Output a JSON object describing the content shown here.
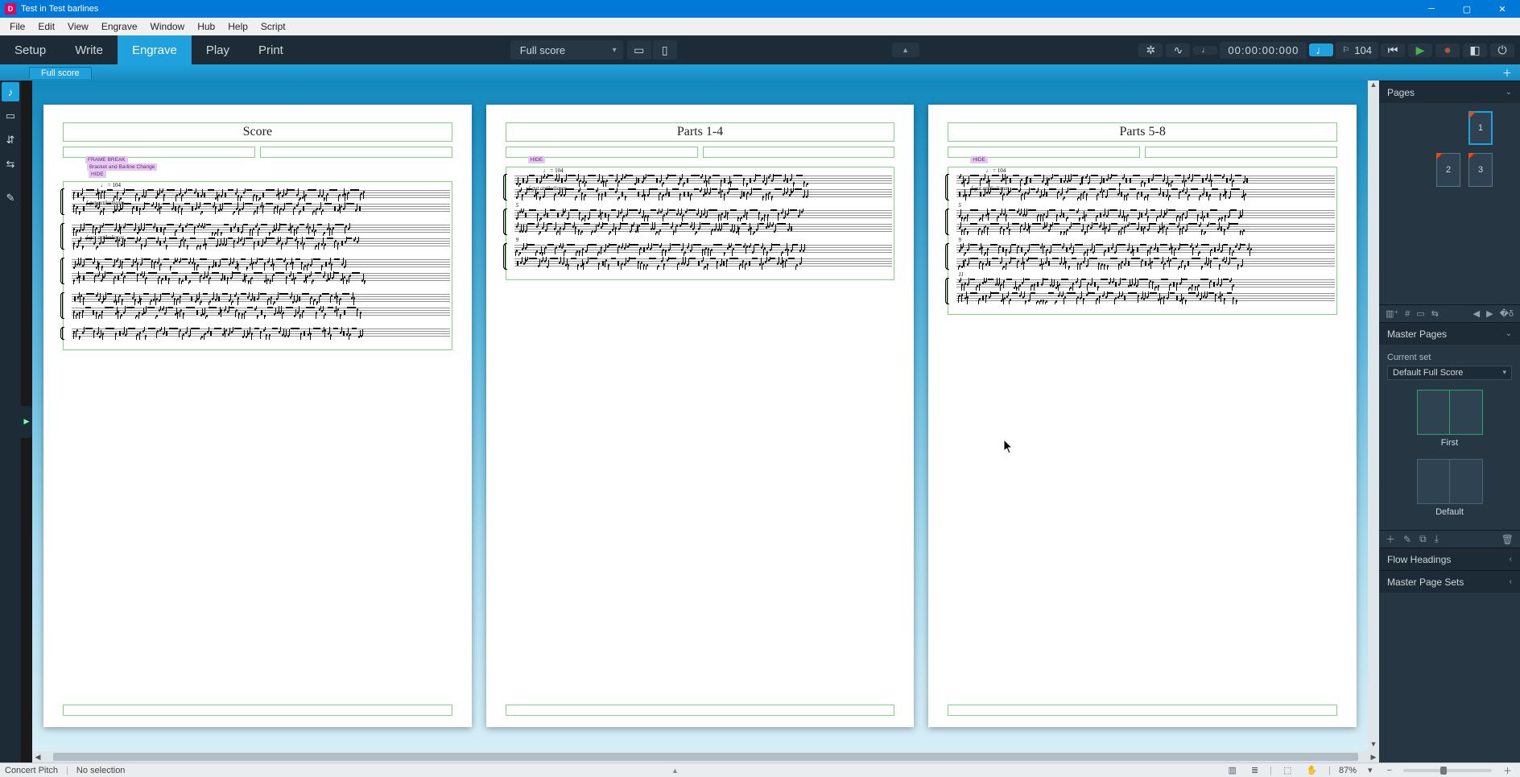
{
  "window": {
    "title": "Test in Test barlines"
  },
  "menubar": [
    "File",
    "Edit",
    "View",
    "Engrave",
    "Window",
    "Hub",
    "Help",
    "Script"
  ],
  "modes": {
    "items": [
      "Setup",
      "Write",
      "Engrave",
      "Play",
      "Print"
    ],
    "active": "Engrave"
  },
  "layout_selector": {
    "value": "Full score"
  },
  "transport": {
    "tempo_note": "♩",
    "tempo_value": "104",
    "timecode": "00:00:00:000"
  },
  "doc_tabs": {
    "items": [
      "Full score"
    ],
    "active": 0
  },
  "canvas": {
    "pages": [
      {
        "title": "Score",
        "signposts": [
          "FRAME BREAK",
          "Bracket and Barline Change",
          "HIDE"
        ],
        "tempo_text": "♩ = 104",
        "dynamic_text": "f  gut artikulieren",
        "systems": [
          {
            "staves": 2,
            "bar_number": null,
            "has_dynamic": true
          },
          {
            "staves": 2,
            "bar_number": null,
            "has_dynamic": true
          },
          {
            "staves": 2,
            "bar_number": null,
            "has_dynamic": false
          },
          {
            "staves": 2,
            "bar_number": null,
            "has_dynamic": false
          },
          {
            "staves": 1,
            "bar_number": null,
            "has_dynamic": false
          }
        ]
      },
      {
        "title": "Parts 1-4",
        "signposts": [
          "HIDE"
        ],
        "tempo_text": "♩ = 104",
        "dynamic_text": "f  gut artikulieren",
        "systems": [
          {
            "staves": 2,
            "bar_number": null,
            "has_dynamic": true
          },
          {
            "staves": 2,
            "bar_number": "5",
            "has_dynamic": false
          },
          {
            "staves": 2,
            "bar_number": "9",
            "has_dynamic": false
          }
        ]
      },
      {
        "title": "Parts 5-8",
        "signposts": [
          "HIDE"
        ],
        "tempo_text": "♩ = 104",
        "dynamic_text": "f  gut artikulieren",
        "systems": [
          {
            "staves": 2,
            "bar_number": null,
            "has_dynamic": true
          },
          {
            "staves": 2,
            "bar_number": "5",
            "has_dynamic": false
          },
          {
            "staves": 2,
            "bar_number": "9",
            "has_dynamic": false
          },
          {
            "staves": 2,
            "bar_number": "11",
            "has_dynamic": false
          }
        ]
      }
    ]
  },
  "right_panel": {
    "pages": {
      "header": "Pages",
      "thumbs": [
        {
          "number": "1",
          "override": true,
          "selected": true
        },
        {
          "number": "2",
          "override": true,
          "selected": false
        },
        {
          "number": "3",
          "override": true,
          "selected": false
        }
      ]
    },
    "master_pages": {
      "header": "Master Pages",
      "current_set_label": "Current set",
      "current_set_value": "Default Full Score",
      "items": [
        {
          "name": "First",
          "accent": true
        },
        {
          "name": "Default",
          "accent": false
        }
      ]
    },
    "flow_headings": {
      "header": "Flow Headings"
    },
    "master_page_sets": {
      "header": "Master Page Sets"
    }
  },
  "statusbar": {
    "pitch_mode": "Concert Pitch",
    "selection": "No selection",
    "zoom_value": "87%"
  },
  "icons": {
    "view_single": "▭",
    "view_spread": "▯▯",
    "movie": "⌘",
    "mixer": "≡",
    "tempo_track": "⎍",
    "note": "♪",
    "rewind": "⏮",
    "play": "▶",
    "record": "⏺",
    "loop": "↻",
    "click": "⏻",
    "power": "⏻",
    "lt_marquee": "⬚",
    "lt_frames": "▭",
    "lt_staff_spacing": "↕",
    "lt_note_spacing": "↔",
    "lt_edit": "✎"
  }
}
